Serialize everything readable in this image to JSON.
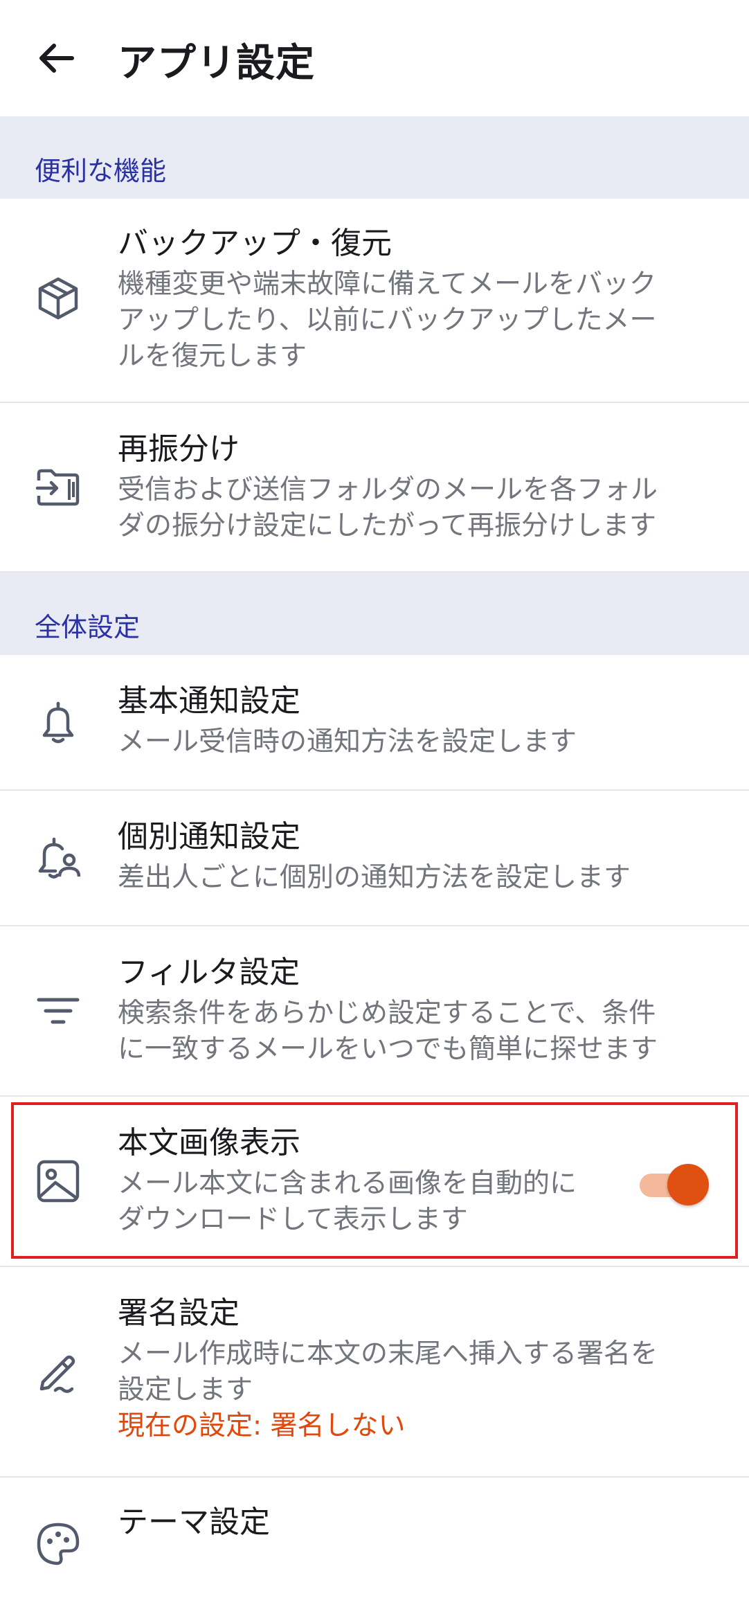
{
  "header": {
    "title": "アプリ設定",
    "back_icon": "arrow-left-icon"
  },
  "sections": {
    "useful": {
      "label": "便利な機能"
    },
    "general": {
      "label": "全体設定"
    }
  },
  "items": {
    "backup": {
      "icon": "box-icon",
      "title": "バックアップ・復元",
      "description": "機種変更や端末故障に備えてメールをバック\nアップしたり、以前にバックアップしたメー\nルを復元します"
    },
    "resort": {
      "icon": "folder-move-icon",
      "title": "再振分け",
      "description": "受信および送信フォルダのメールを各フォル\nダの振分け設定にしたがって再振分けします"
    },
    "basic_notify": {
      "icon": "bell-icon",
      "title": "基本通知設定",
      "description": "メール受信時の通知方法を設定します"
    },
    "individual_notify": {
      "icon": "bell-person-icon",
      "title": "個別通知設定",
      "description": "差出人ごとに個別の通知方法を設定します"
    },
    "filter": {
      "icon": "filter-icon",
      "title": "フィルタ設定",
      "description": "検索条件をあらかじめ設定することで、条件\nに一致するメールをいつでも簡単に探せます"
    },
    "image_display": {
      "icon": "image-icon",
      "title": "本文画像表示",
      "description": "メール本文に含まれる画像を自動的に\nダウンロードして表示します",
      "toggle_on": true
    },
    "signature": {
      "icon": "pen-icon",
      "title": "署名設定",
      "description": "メール作成時に本文の末尾へ挿入する署名を\n設定します",
      "status": "現在の設定: 署名しない"
    },
    "theme": {
      "icon": "palette-icon",
      "title": "テーマ設定"
    }
  },
  "colors": {
    "accent": "#e05010",
    "section_bg": "#e9ebf4",
    "section_text": "#2a31a3",
    "highlight_border": "#e02020"
  }
}
